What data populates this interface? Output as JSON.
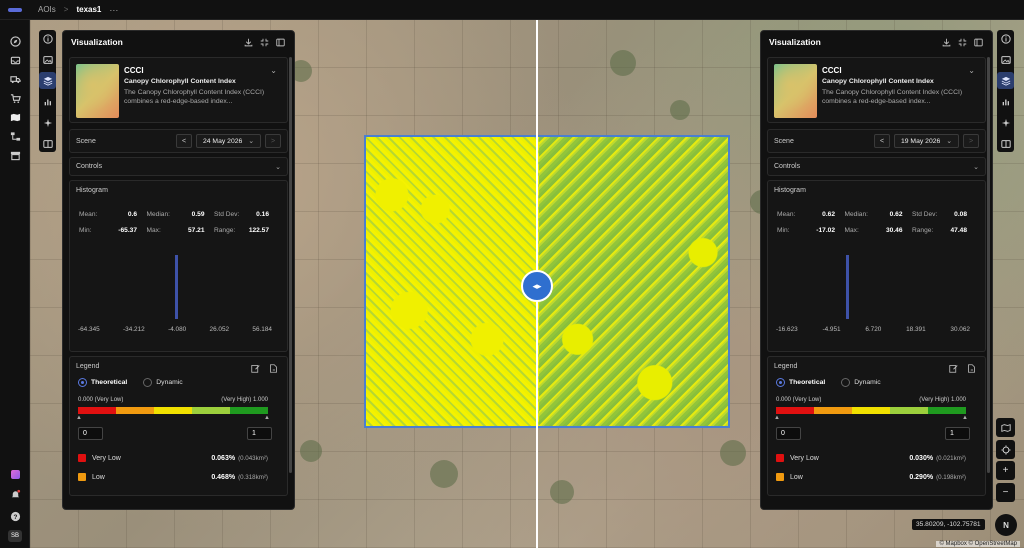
{
  "breadcrumb": {
    "root": "AOIs",
    "separator": ">",
    "current": "texas1",
    "more": "···"
  },
  "user": {
    "initials": "SB"
  },
  "split_handle": {
    "left_arrow": "◂",
    "right_arrow": "▸"
  },
  "map": {
    "coords": "35.80209, -102.75781",
    "attribution": "© Mapbox © OpenStreetMap"
  },
  "panels": [
    {
      "title": "Visualization",
      "layer": {
        "code": "CCCI",
        "name": "Canopy Chlorophyll Content Index",
        "description": "The Canopy Chlorophyll Content Index (CCCI) combines a red-edge-based index..."
      },
      "scene": {
        "label": "Scene",
        "date": "24 May 2026"
      },
      "controls": {
        "label": "Controls"
      },
      "histogram": {
        "title": "Histogram",
        "mean_label": "Mean:",
        "mean": "0.6",
        "median_label": "Median:",
        "median": "0.59",
        "std_label": "Std Dev:",
        "std": "0.16",
        "min_label": "Min:",
        "min": "-65.37",
        "max_label": "Max:",
        "max": "57.21",
        "range_label": "Range:",
        "range": "122.57",
        "ticks": [
          "-64.345",
          "-34.212",
          "-4.080",
          "26.052",
          "56.184"
        ],
        "peak_position": 0.5
      },
      "legend": {
        "title": "Legend",
        "modes": [
          "Theoretical",
          "Dynamic"
        ],
        "selected_mode": "Theoretical",
        "low_label": "0.000 (Very Low)",
        "high_label": "(Very High) 1.000",
        "min_input": "0",
        "max_input": "1",
        "classes": [
          {
            "name": "Very Low",
            "pct": "0.063%",
            "area": "(0.043km²)",
            "color": "#e01010"
          },
          {
            "name": "Low",
            "pct": "0.468%",
            "area": "(0.318km²)",
            "color": "#f09a10"
          }
        ]
      }
    },
    {
      "title": "Visualization",
      "layer": {
        "code": "CCCI",
        "name": "Canopy Chlorophyll Content Index",
        "description": "The Canopy Chlorophyll Content Index (CCCI) combines a red-edge-based index..."
      },
      "scene": {
        "label": "Scene",
        "date": "19 May 2026"
      },
      "controls": {
        "label": "Controls"
      },
      "histogram": {
        "title": "Histogram",
        "mean_label": "Mean:",
        "mean": "0.62",
        "median_label": "Median:",
        "median": "0.62",
        "std_label": "Std Dev:",
        "std": "0.08",
        "min_label": "Min:",
        "min": "-17.02",
        "max_label": "Max:",
        "max": "30.46",
        "range_label": "Range:",
        "range": "47.48",
        "ticks": [
          "-16.623",
          "-4.951",
          "6.720",
          "18.391",
          "30.062"
        ],
        "peak_position": 0.36
      },
      "legend": {
        "title": "Legend",
        "modes": [
          "Theoretical",
          "Dynamic"
        ],
        "selected_mode": "Theoretical",
        "low_label": "0.000 (Very Low)",
        "high_label": "(Very High) 1.000",
        "min_input": "0",
        "max_input": "1",
        "classes": [
          {
            "name": "Very Low",
            "pct": "0.030%",
            "area": "(0.021km²)",
            "color": "#e01010"
          },
          {
            "name": "Low",
            "pct": "0.290%",
            "area": "(0.198km²)",
            "color": "#f09a10"
          }
        ]
      }
    }
  ],
  "ramp_colors": [
    "#e01010",
    "#f09a10",
    "#f0e000",
    "#9ccf3c",
    "#1f9a1f"
  ],
  "nav": {
    "prev": "<",
    "next": ">",
    "chevron": "⌄"
  },
  "map_controls": {
    "zoom_in": "+",
    "zoom_out": "−",
    "compass": "N"
  }
}
